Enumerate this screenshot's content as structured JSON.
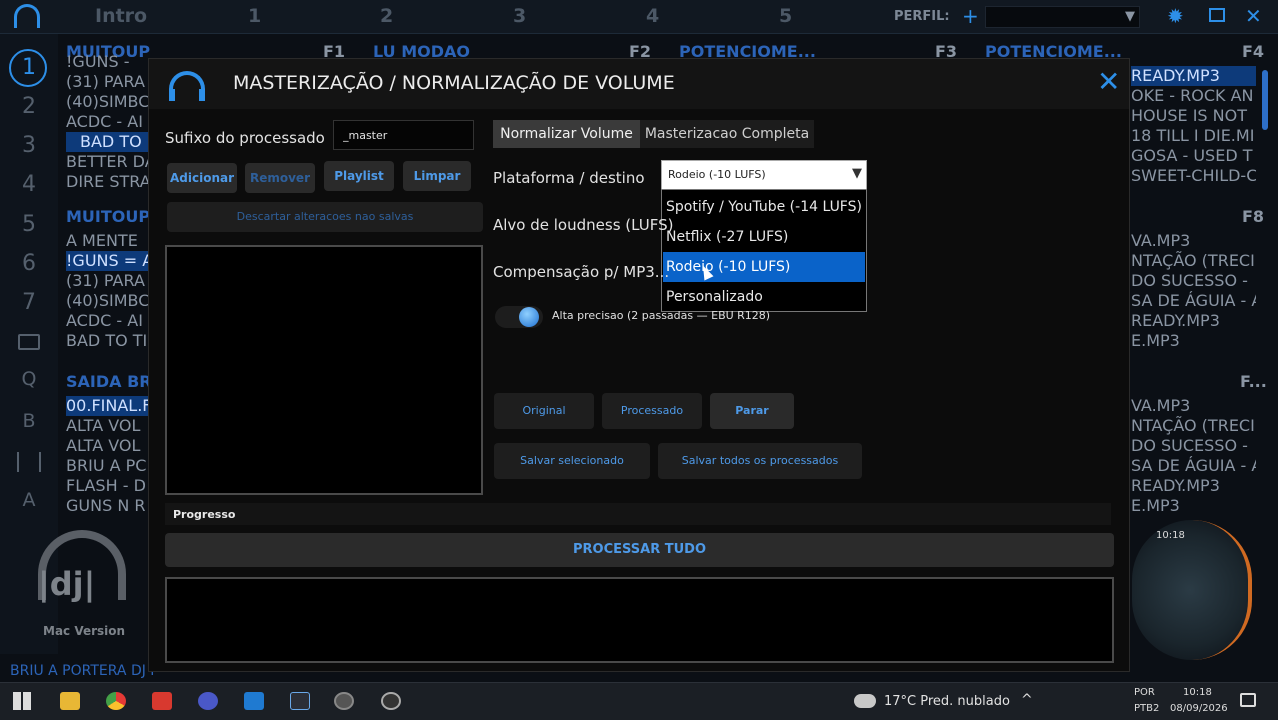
{
  "topbar": {
    "tabs": [
      "Intro",
      "1",
      "2",
      "3",
      "4",
      "5"
    ],
    "profile_label": "PERFIL:"
  },
  "leftnav": {
    "items": [
      "1",
      "2",
      "3",
      "4",
      "5",
      "6",
      "7",
      "Q",
      "B",
      "A"
    ]
  },
  "background": {
    "deck_headers": [
      "MUITOUP",
      "LU MODAO",
      "POTENCIOME...",
      "POTENCIOME...",
      "MUITOUP",
      "SAIDA BR"
    ],
    "deck_keys": [
      "F1",
      "F2",
      "F3",
      "F4",
      "F8",
      "F..."
    ],
    "list_left_1": [
      "!GUNS -",
      "(31) PARA",
      "(40)SIMBC",
      "ACDC - AI",
      "BAD TO",
      "BETTER DA",
      "DIRE STRA"
    ],
    "list_left_2": [
      "A MENTE",
      "!GUNS = A",
      "(31) PARA",
      "(40)SIMBC",
      "ACDC - AI",
      "BAD TO TI"
    ],
    "list_left_3": [
      "00.FINAL.F",
      "ALTA VOL",
      "ALTA VOL",
      "BRIU A PC",
      "FLASH - D",
      "GUNS N R"
    ],
    "list_right_1": [
      "READY.MP3",
      "OKE - ROCK AN",
      "HOUSE IS NOT",
      "18 TILL I DIE.MI",
      "GOSA - USED T",
      "SWEET-CHILD-C"
    ],
    "list_right_2": [
      "VA.MP3",
      "NTAÇÃO (TRECI",
      "DO SUCESSO -",
      "SA DE ÁGUIA - A",
      "READY.MP3",
      "E.MP3"
    ],
    "list_right_3": [
      "VA.MP3",
      "NTAÇÃO (TRECI",
      "DO SUCESSO -",
      "SA DE ÁGUIA - A",
      "READY.MP3",
      "E.MP3"
    ],
    "mac_version": "Mac Version",
    "logo_text": "|dj|",
    "bottom_text": "BRIU A PORTERA DJ I",
    "clock": "10:18"
  },
  "dialog": {
    "title": "MASTERIZAÇÃO / NORMALIZAÇÃO DE VOLUME",
    "suffix_label": "Sufixo do processado",
    "suffix_value": "_master",
    "buttons": {
      "add": "Adicionar",
      "remove": "Remover",
      "playlist": "Playlist",
      "clear": "Limpar",
      "discard": "Descartar alteracoes nao salvas",
      "original": "Original",
      "processed": "Processado",
      "stop": "Parar",
      "save_selected": "Salvar selecionado",
      "save_all": "Salvar todos os processados",
      "process_all": "PROCESSAR TUDO"
    },
    "tabs": [
      "Normalizar Volume",
      "Masterizacao Completa"
    ],
    "platform_label": "Plataforma / destino",
    "platform_selected": "Rodeio (-10 LUFS)",
    "platform_options": [
      "Spotify / YouTube (-14 LUFS)",
      "Netflix (-27 LUFS)",
      "Rodeio (-10 LUFS)",
      "Personalizado"
    ],
    "loudness_label": "Alvo de loudness (LUFS)",
    "compensation_label": "Compensação p/ MP3...",
    "high_precision_label": "Alta precisao (2 passadas — EBU R128)",
    "progress_label": "Progresso"
  },
  "taskbar": {
    "weather": "17°C  Pred. nublado",
    "lang_1": "POR",
    "lang_2": "PTB2",
    "time": "10:18",
    "date": "08/09/2026"
  },
  "colors": {
    "accent": "#2d8fe8",
    "selected_option": "#0a63c9",
    "button_bg": "#2a2a2a"
  }
}
